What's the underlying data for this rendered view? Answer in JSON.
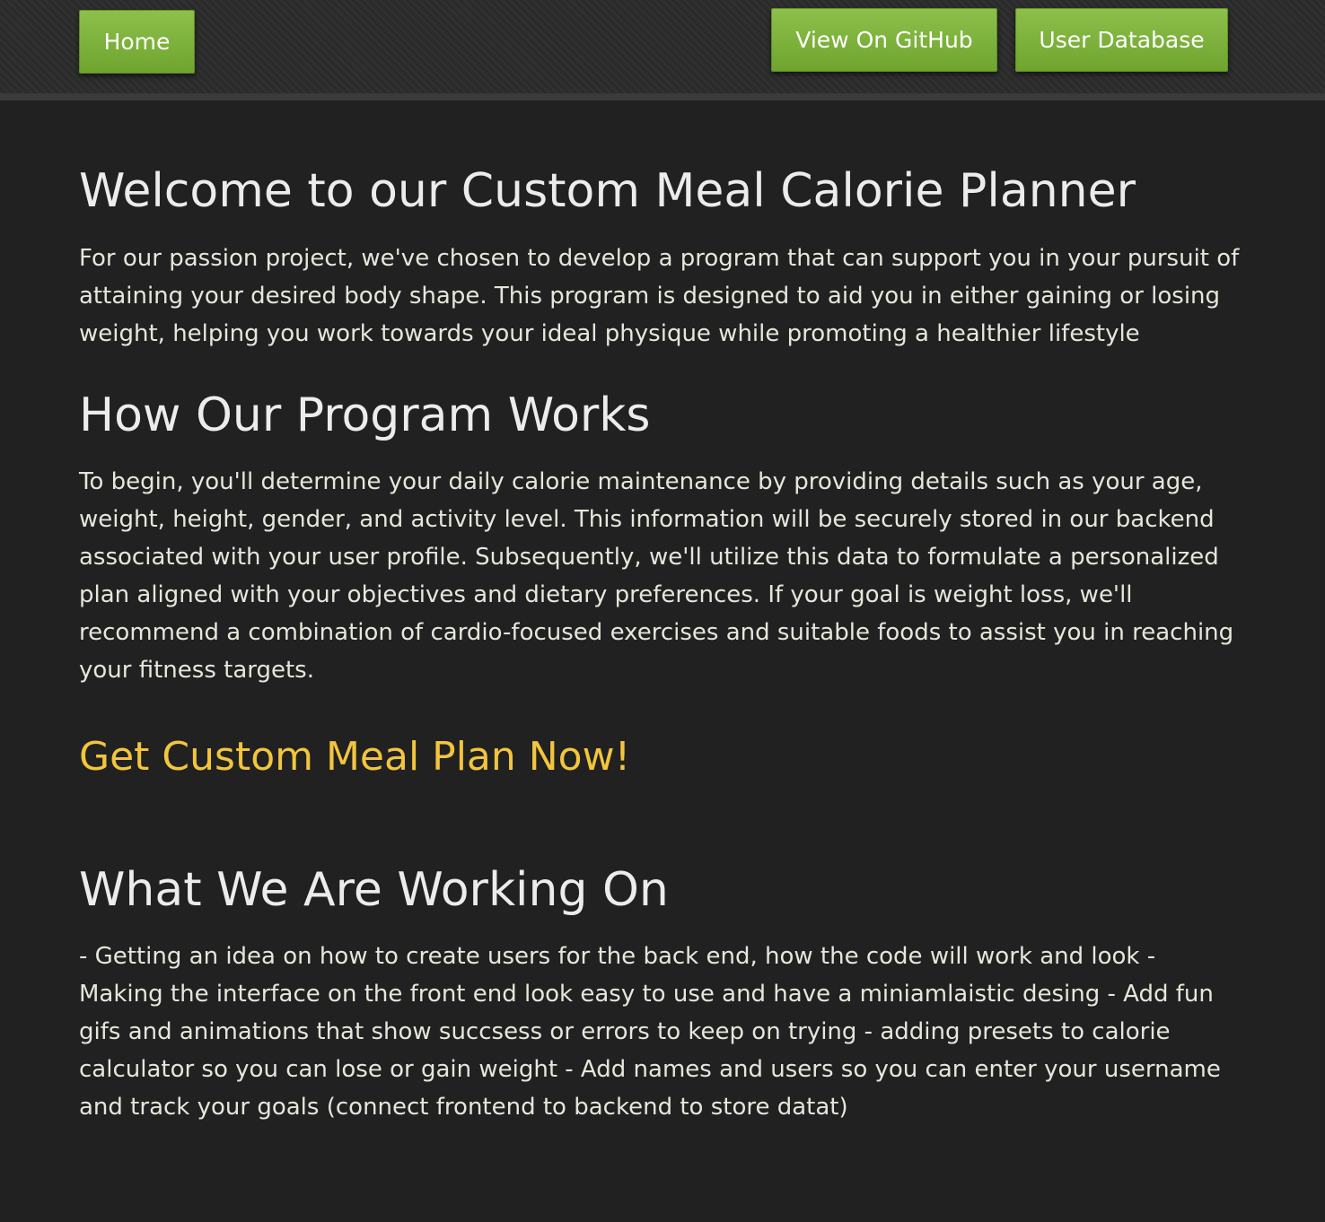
{
  "nav": {
    "home_label": "Home",
    "github_label": "View On GitHub",
    "database_label": "User Database"
  },
  "main": {
    "title": "Welcome to our Custom Meal Calorie Planner",
    "intro": "For our passion project, we've chosen to develop a program that can support you in your pursuit of attaining your desired body shape. This program is designed to aid you in either gaining or losing weight, helping you work towards your ideal physique while promoting a healthier lifestyle",
    "how_heading": "How Our Program Works",
    "how_text": "To begin, you'll determine your daily calorie maintenance by providing details such as your age, weight, height, gender, and activity level. This information will be securely stored in our backend associated with your user profile. Subsequently, we'll utilize this data to formulate a personalized plan aligned with your objectives and dietary preferences. If your goal is weight loss, we'll recommend a combination of cardio-focused exercises and suitable foods to assist you in reaching your fitness targets.",
    "cta_label": "Get Custom Meal Plan Now!",
    "working_heading": "What We Are Working On",
    "working_text": "- Getting an idea on how to create users for the back end, how the code will work and look - Making the interface on the front end look easy to use and have a miniamlaistic desing - Add fun gifs and animations that show succsess or errors to keep on trying - adding presets to calorie calculator so you can lose or gain weight - Add names and users so you can enter your username and track your goals (connect frontend to backend to store datat)"
  },
  "colors": {
    "background": "#212121",
    "button_green": "#7cb342",
    "cta_yellow": "#f2c53d",
    "text": "#e6e6dc"
  }
}
